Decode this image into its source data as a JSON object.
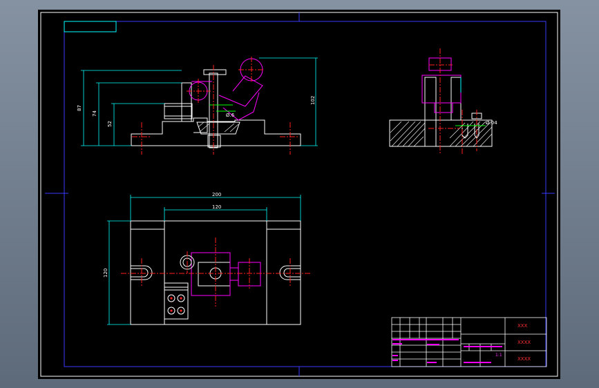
{
  "dimensions": {
    "front_height_overall": "87",
    "front_height_mid": "74",
    "front_height_low": "52",
    "front_height_right": "102",
    "tolerance_note_1": "Ø.6",
    "tolerance_note_2": "",
    "side_tolerance": "Ø.04",
    "top_width_overall": "200",
    "top_width_inner": "120",
    "top_height": "120"
  },
  "title_block": {
    "drawing_name": "XXX",
    "field_2": "XXXX",
    "field_3": "XXXX",
    "scale": "1:1"
  },
  "colors": {
    "outline": "#ffffff",
    "border": "#3a3aff",
    "dimension": "#00ffff",
    "centerline": "#ff2020",
    "component": "#ff00ff",
    "tolerance": "#00ff00"
  }
}
